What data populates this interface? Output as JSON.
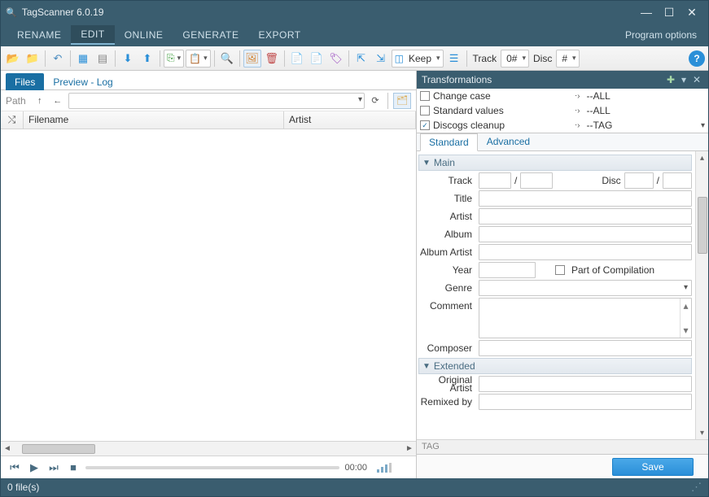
{
  "titlebar": {
    "app_title": "TagScanner 6.0.19"
  },
  "menubar": {
    "items": [
      "RENAME",
      "EDIT",
      "ONLINE",
      "GENERATE",
      "EXPORT"
    ],
    "active_index": 1,
    "program_options": "Program options"
  },
  "toolbar": {
    "keep_label": "Keep",
    "track_label": "Track",
    "track_value": "0#",
    "disc_label": "Disc",
    "disc_value": "#"
  },
  "left_tabs": {
    "files": "Files",
    "preview": "Preview - Log"
  },
  "path": {
    "label": "Path"
  },
  "columns": {
    "filename": "Filename",
    "artist": "Artist"
  },
  "player": {
    "time": "00:00"
  },
  "trans": {
    "title": "Transformations",
    "rows": [
      {
        "checked": false,
        "name": "Change case",
        "value": "--ALL"
      },
      {
        "checked": false,
        "name": "Standard values",
        "value": "--ALL"
      },
      {
        "checked": true,
        "name": "Discogs cleanup",
        "value": "--TAG"
      }
    ]
  },
  "right_tabs": {
    "standard": "Standard",
    "advanced": "Advanced"
  },
  "sections": {
    "main": "Main",
    "extended": "Extended"
  },
  "labels": {
    "track": "Track",
    "disc": "Disc",
    "title": "Title",
    "artist": "Artist",
    "album": "Album",
    "album_artist": "Album Artist",
    "year": "Year",
    "part_comp": "Part of Compilation",
    "genre": "Genre",
    "comment": "Comment",
    "composer": "Composer",
    "orig_artist": "Original Artist",
    "remixed": "Remixed by"
  },
  "tag_footer": "TAG",
  "save": "Save",
  "status": {
    "files": "0 file(s)"
  }
}
